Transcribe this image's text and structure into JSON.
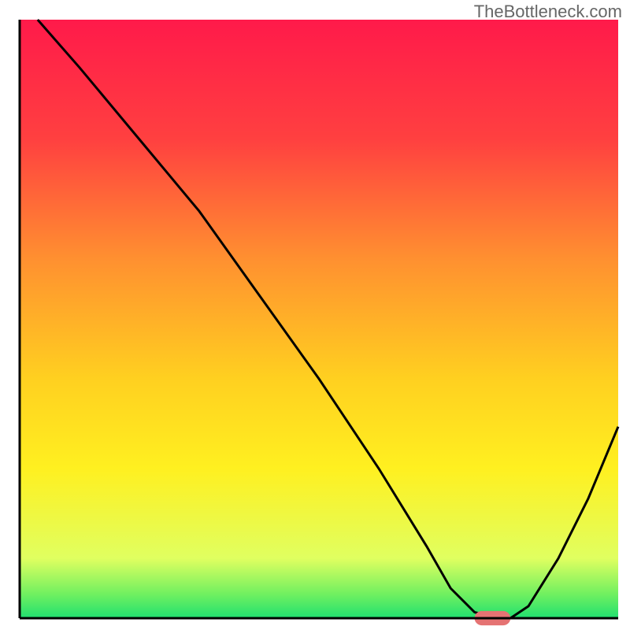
{
  "watermark": "TheBottleneck.com",
  "chart_data": {
    "type": "line",
    "title": "",
    "xlabel": "",
    "ylabel": "",
    "xlim": [
      0,
      100
    ],
    "ylim": [
      0,
      100
    ],
    "gradient_stops": [
      {
        "offset": 0,
        "color": "#ff1a4a"
      },
      {
        "offset": 20,
        "color": "#ff4040"
      },
      {
        "offset": 40,
        "color": "#ff9030"
      },
      {
        "offset": 60,
        "color": "#ffd020"
      },
      {
        "offset": 75,
        "color": "#fff020"
      },
      {
        "offset": 90,
        "color": "#e0ff60"
      },
      {
        "offset": 96,
        "color": "#70f060"
      },
      {
        "offset": 100,
        "color": "#20e070"
      }
    ],
    "series": [
      {
        "name": "bottleneck-curve",
        "color": "#000000",
        "x": [
          3,
          10,
          20,
          25,
          30,
          40,
          50,
          60,
          68,
          72,
          76,
          80,
          82,
          85,
          90,
          95,
          100
        ],
        "y": [
          100,
          92,
          80,
          74,
          68,
          54,
          40,
          25,
          12,
          5,
          1,
          0,
          0,
          2,
          10,
          20,
          32
        ]
      }
    ],
    "marker": {
      "name": "optimal-range",
      "color": "#e57373",
      "x_start": 76,
      "x_end": 82,
      "y": 0,
      "thickness": 1.2
    },
    "axes": {
      "color": "#000000",
      "show_ticks": false,
      "show_grid": false
    }
  }
}
